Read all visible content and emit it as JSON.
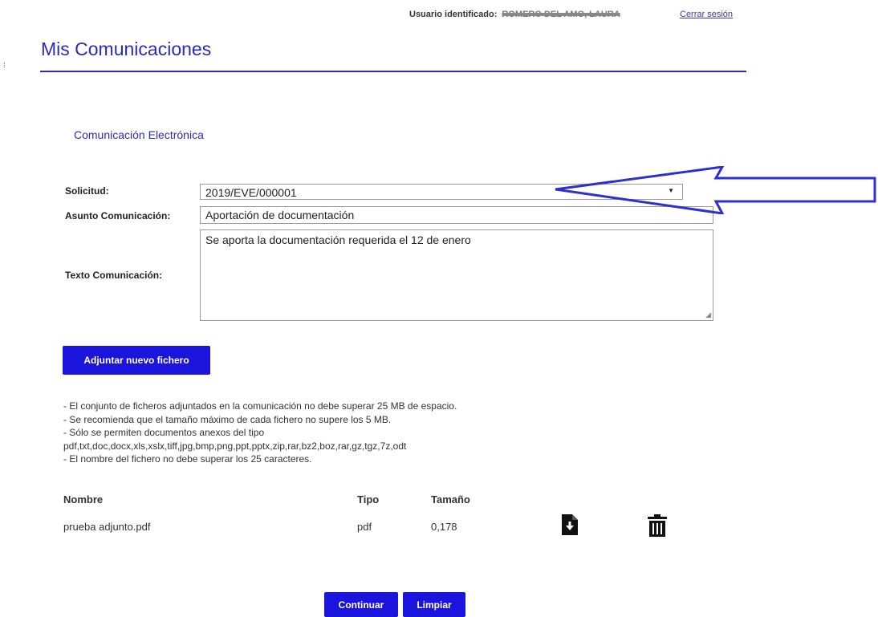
{
  "header": {
    "user_label": "Usuario identificado:",
    "user_name": "ROMERO DEL AMO, LAURA",
    "logout": "Cerrar sesión"
  },
  "page": {
    "title": "Mis Comunicaciones",
    "section_title": "Comunicación Electrónica"
  },
  "form": {
    "solicitud_label": "Solicitud:",
    "solicitud_value": "2019/EVE/000001",
    "asunto_label": "Asunto Comunicación:",
    "asunto_value": "Aportación de documentación",
    "texto_label": "Texto Comunicación:",
    "texto_value": "Se aporta la documentación requerida el 12 de enero"
  },
  "attach_button": "Adjuntar nuevo fichero",
  "notes": [
    "- El conjunto de ficheros adjuntados en la comunicación no debe superar 25 MB de espacio.",
    "- Se recomienda que el tamaño máximo de cada fichero no supere los 5 MB.",
    "- Sólo se permiten documentos anexos del tipo",
    "pdf,txt,doc,docx,xls,xslx,tiff,jpg,bmp,png,ppt,pptx,zip,rar,bz2,boz,rar,gz,tgz,7z,odt",
    "- El nombre del fichero no debe superar los 25 caracteres."
  ],
  "files_table": {
    "headers": [
      "Nombre",
      "Tipo",
      "Tamaño"
    ],
    "rows": [
      {
        "name": "prueba adjunto.pdf",
        "type": "pdf",
        "size": "0,178"
      }
    ]
  },
  "icons": {
    "download": "file-download-icon",
    "delete": "trash-icon",
    "arrow": "left-arrow-annotation",
    "dropdown": "chevron-down-icon"
  },
  "actions": {
    "continue": "Continuar",
    "clear": "Limpiar"
  },
  "colors": {
    "accent": "#2c2ab8",
    "button": "#1a14dd",
    "arrow": "#2f2ed0"
  }
}
